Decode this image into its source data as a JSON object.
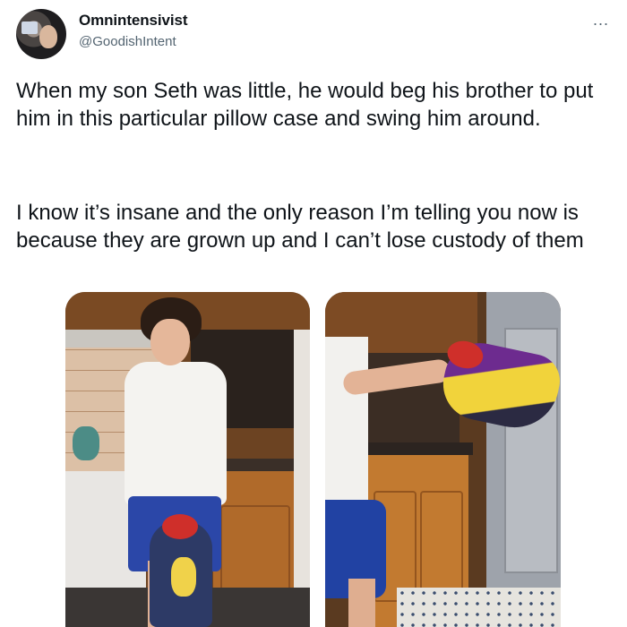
{
  "tweet": {
    "author": {
      "display_name": "Omnintensivist",
      "handle": "@GoodishIntent"
    },
    "more_label": "...",
    "paragraphs": [
      "When my son Seth was little, he would beg his brother to put him in this particular pillow case and swing him around.",
      "I know it’s insane and the only reason I’m telling you now is because they are grown up and I can’t lose custody of them"
    ]
  },
  "icons": {
    "more": "ellipsis-icon",
    "avatar": "user-avatar"
  }
}
